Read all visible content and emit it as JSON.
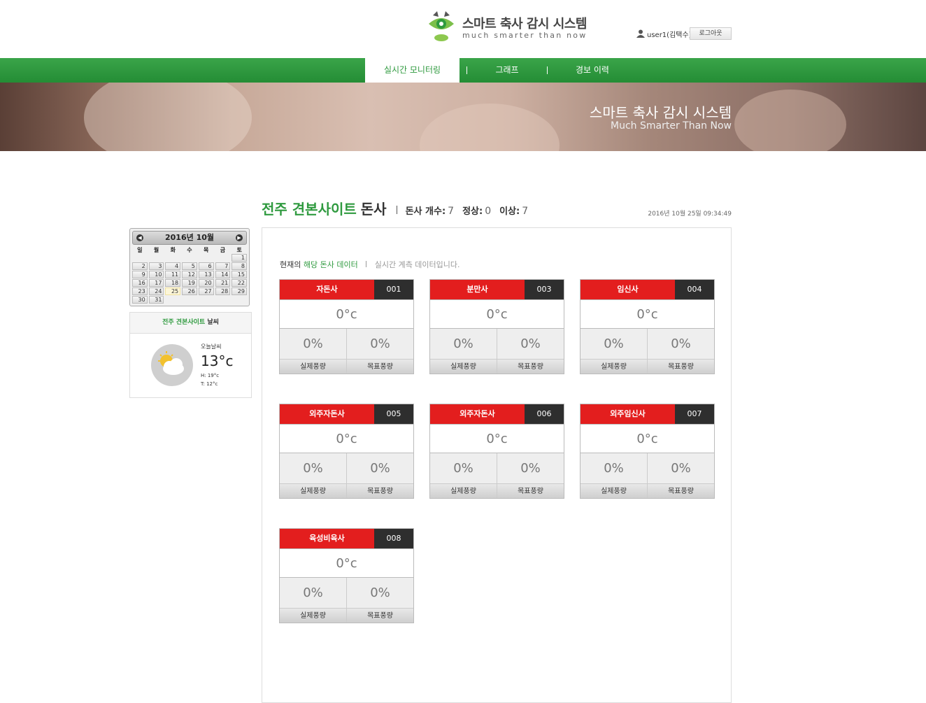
{
  "header": {
    "logo_title": "스마트 축사 감시 시스템",
    "logo_subtitle": "much smarter than now",
    "user": "user1(김택수)",
    "logout_label": "로그아웃",
    "icons": {
      "logo": "pig-eye-logo-icon",
      "user": "user-icon"
    }
  },
  "nav": {
    "items": [
      {
        "label": "실시간 모니터링",
        "active": true
      },
      {
        "label": "그래프",
        "active": false
      },
      {
        "label": "경보 이력",
        "active": false
      }
    ],
    "colors": {
      "bar": "#2f9a3f",
      "active_text": "#2f9a3f"
    }
  },
  "banner": {
    "title": "스마트 축사 감시 시스템",
    "subtitle": "Much Smarter Than Now"
  },
  "page": {
    "site_name": "전주 견본사이트",
    "site_suffix": "돈사",
    "count_label": "돈사 개수:",
    "count_value": "7",
    "normal_label": "정상:",
    "normal_value": "0",
    "abnormal_label": "이상:",
    "abnormal_value": "7",
    "datetime": "2016년 10월 25일 09:34:49"
  },
  "calendar": {
    "title": "2016년 10월",
    "weekdays": [
      "일",
      "월",
      "화",
      "수",
      "목",
      "금",
      "토"
    ],
    "first_weekday": 6,
    "days_in_month": 31,
    "today": 25,
    "icons": {
      "prev": "prev-month-icon",
      "next": "next-month-icon"
    }
  },
  "weather": {
    "head_site": "전주 견본사이트",
    "head_suffix": "날씨",
    "today_label": "오늘날씨",
    "temp": "13°c",
    "high": "H: 19°c",
    "low": "T: 12°c",
    "icon": "partly-cloudy-icon"
  },
  "panel": {
    "intro_prefix": "현재의",
    "intro_highlight": "해당 돈사 데이터",
    "intro_note": "실시간 계측 데이터입니다."
  },
  "barns": [
    {
      "name": "자돈사",
      "code": "001",
      "temp": "0°c",
      "actual": "0%",
      "target": "0%",
      "actual_label": "실제풍량",
      "target_label": "목표풍량"
    },
    {
      "name": "분만사",
      "code": "003",
      "temp": "0°c",
      "actual": "0%",
      "target": "0%",
      "actual_label": "실제풍량",
      "target_label": "목표풍량"
    },
    {
      "name": "임신사",
      "code": "004",
      "temp": "0°c",
      "actual": "0%",
      "target": "0%",
      "actual_label": "실제풍량",
      "target_label": "목표풍량"
    },
    {
      "name": "외주자돈사",
      "code": "005",
      "temp": "0°c",
      "actual": "0%",
      "target": "0%",
      "actual_label": "실제풍량",
      "target_label": "목표풍량"
    },
    {
      "name": "외주자돈사",
      "code": "006",
      "temp": "0°c",
      "actual": "0%",
      "target": "0%",
      "actual_label": "실제풍량",
      "target_label": "목표풍량"
    },
    {
      "name": "외주임신사",
      "code": "007",
      "temp": "0°c",
      "actual": "0%",
      "target": "0%",
      "actual_label": "실제풍량",
      "target_label": "목표풍량"
    },
    {
      "name": "육성비육사",
      "code": "008",
      "temp": "0°c",
      "actual": "0%",
      "target": "0%",
      "actual_label": "실제풍량",
      "target_label": "목표풍량"
    }
  ],
  "colors": {
    "alarm": "#e31e1e",
    "code_bg": "#2e2e2e",
    "accent": "#2f9a3f"
  }
}
